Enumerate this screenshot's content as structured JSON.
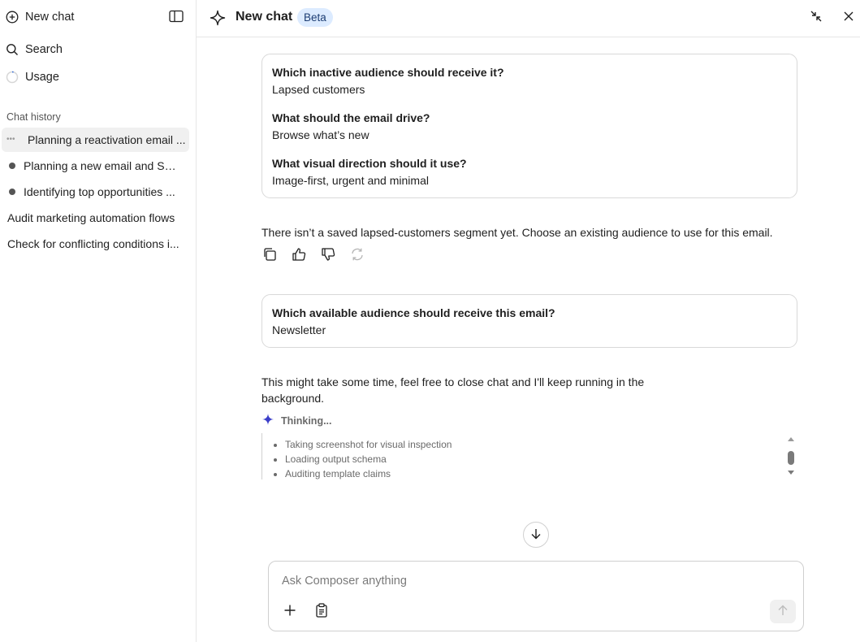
{
  "sidebar": {
    "new_chat_label": "New chat",
    "search_label": "Search",
    "usage_label": "Usage",
    "chat_history_title": "Chat history",
    "history": [
      {
        "label": "Planning a reactivation email ...",
        "status": "in-progress",
        "active": true
      },
      {
        "label": "Planning a new email and SM...",
        "status": "dot"
      },
      {
        "label": "Identifying top opportunities ...",
        "status": "dot"
      },
      {
        "label": "Audit marketing automation flows",
        "status": "none"
      },
      {
        "label": "Check for conflicting conditions i...",
        "status": "none"
      }
    ]
  },
  "header": {
    "title": "New chat",
    "badge": "Beta"
  },
  "conversation": {
    "answers_card": [
      {
        "question": "Which inactive audience should receive it?",
        "answer": "Lapsed customers"
      },
      {
        "question": "What should the email drive?",
        "answer": "Browse what’s new"
      },
      {
        "question": "What visual direction should it use?",
        "answer": "Image-first, urgent and minimal"
      }
    ],
    "assistant_message": "There isn’t a saved lapsed-customers segment yet. Choose an existing audience to use for this email.",
    "audience_card": {
      "question": "Which available audience should receive this email?",
      "answer": "Newsletter"
    },
    "background_message": "This might take some time, feel free to close chat and I'll keep running in the background.",
    "thinking_label": "Thinking...",
    "thinking_steps": [
      "Taking screenshot for visual inspection",
      "Loading output schema",
      "Auditing template claims"
    ]
  },
  "composer": {
    "placeholder": "Ask Composer anything"
  },
  "icons": {
    "new_chat": "plus-circle-icon",
    "toggle_sidebar": "sidebar-toggle-icon",
    "search": "search-icon",
    "usage": "usage-ring-icon",
    "sparkle": "sparkle-icon",
    "collapse": "collapse-icon",
    "close": "close-icon",
    "copy": "copy-icon",
    "thumbs_up": "thumbs-up-icon",
    "thumbs_down": "thumbs-down-icon",
    "regenerate": "regenerate-icon",
    "scroll_down": "arrow-down-icon",
    "attach": "plus-icon",
    "clipboard": "clipboard-icon",
    "send": "arrow-up-icon"
  },
  "colors": {
    "accent_sparkle": "#3b3ec9",
    "badge_bg": "#dcebff",
    "badge_text": "#1d3d73"
  }
}
